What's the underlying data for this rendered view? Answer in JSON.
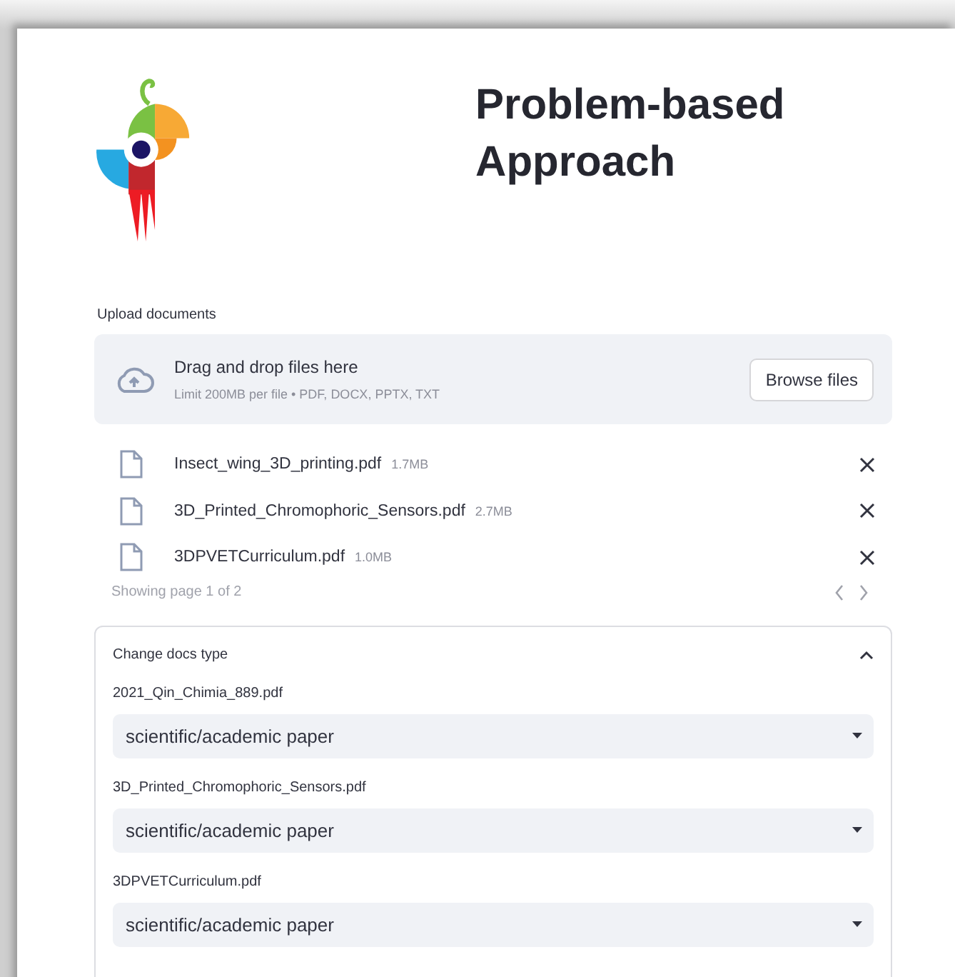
{
  "header": {
    "title": "Problem-based Approach"
  },
  "uploader": {
    "label": "Upload documents",
    "drop_text": "Drag and drop files here",
    "limit_text": "Limit 200MB per file • PDF, DOCX, PPTX, TXT",
    "button": "Browse files"
  },
  "files": [
    {
      "name": "Insect_wing_3D_printing.pdf",
      "size": "1.7MB"
    },
    {
      "name": "3D_Printed_Chromophoric_Sensors.pdf",
      "size": "2.7MB"
    },
    {
      "name": "3DPVETCurriculum.pdf",
      "size": "1.0MB"
    }
  ],
  "pagination": {
    "text": "Showing page 1 of 2"
  },
  "expander": {
    "title": "Change docs type",
    "expanded": true,
    "items": [
      {
        "label": "2021_Qin_Chimia_889.pdf",
        "value": "scientific/academic paper"
      },
      {
        "label": "3D_Printed_Chromophoric_Sensors.pdf",
        "value": "scientific/academic paper"
      },
      {
        "label": "3DPVETCurriculum.pdf",
        "value": "scientific/academic paper"
      }
    ]
  }
}
